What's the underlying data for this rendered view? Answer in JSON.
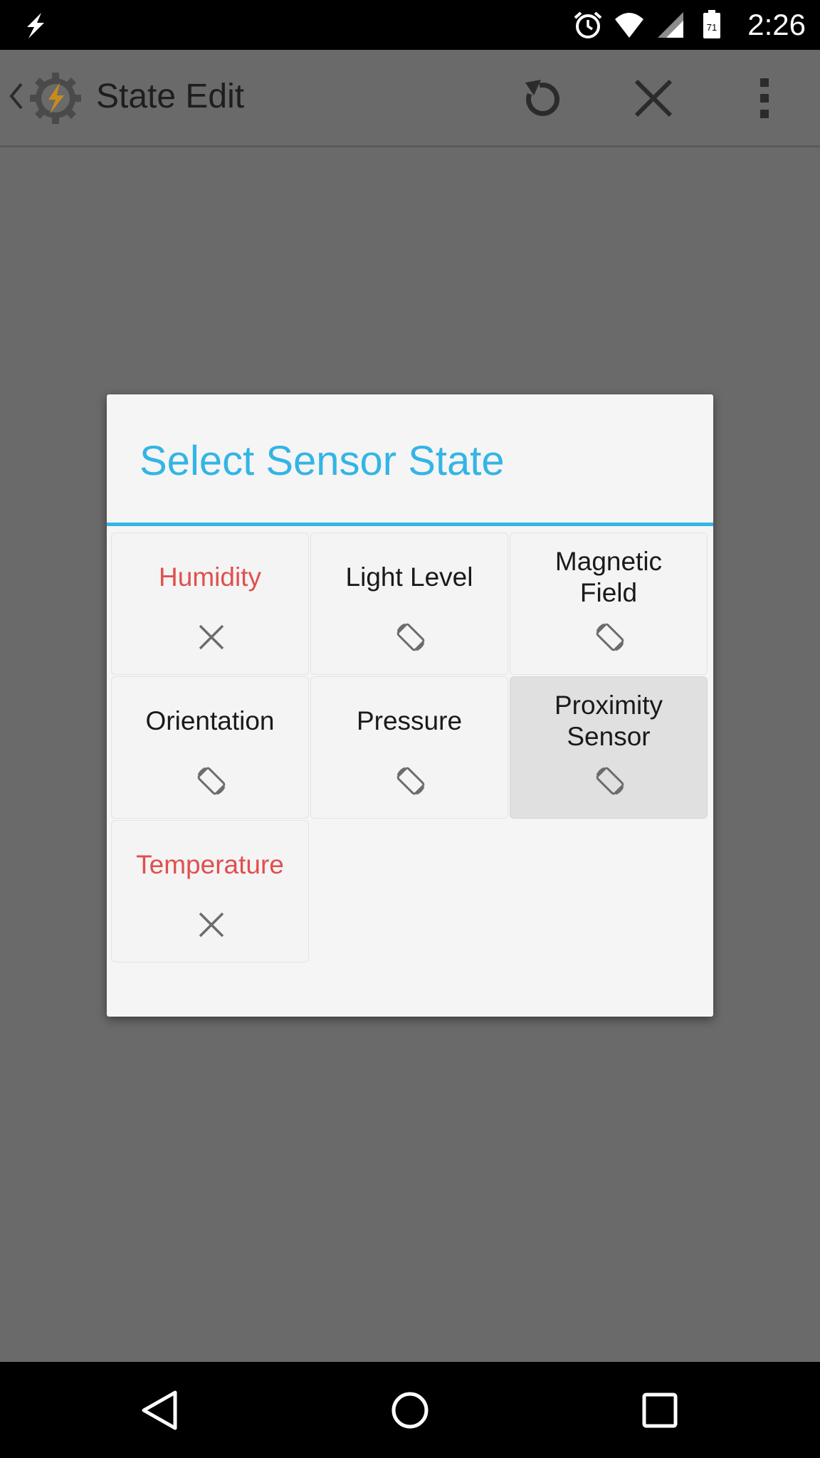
{
  "status_bar": {
    "time": "2:26",
    "battery_level": "71",
    "icons": [
      "tasker-notification-icon",
      "alarm-icon",
      "wifi-icon",
      "signal-icon",
      "battery-icon"
    ]
  },
  "app_bar": {
    "title": "State Edit",
    "icons": [
      "back-chevron-icon",
      "tasker-logo-icon",
      "reset-icon",
      "close-icon",
      "overflow-menu-icon"
    ]
  },
  "dialog": {
    "title": "Select Sensor State",
    "accent_color": "#33b5e5",
    "unavailable_color": "#e0504f",
    "items": [
      {
        "label": "Humidity",
        "status": "unavailable",
        "icon": "x-mark-icon"
      },
      {
        "label": "Light Level",
        "status": "available",
        "icon": "screen-rotation-icon"
      },
      {
        "label": "Magnetic Field",
        "status": "available",
        "icon": "screen-rotation-icon"
      },
      {
        "label": "Orientation",
        "status": "available",
        "icon": "screen-rotation-icon"
      },
      {
        "label": "Pressure",
        "status": "available",
        "icon": "screen-rotation-icon"
      },
      {
        "label": "Proximity Sensor",
        "status": "available",
        "icon": "screen-rotation-icon",
        "selected": true
      },
      {
        "label": "Temperature",
        "status": "unavailable",
        "icon": "x-mark-icon"
      }
    ]
  },
  "nav_bar": {
    "icons": [
      "back-triangle-icon",
      "home-circle-icon",
      "recents-square-icon"
    ]
  }
}
